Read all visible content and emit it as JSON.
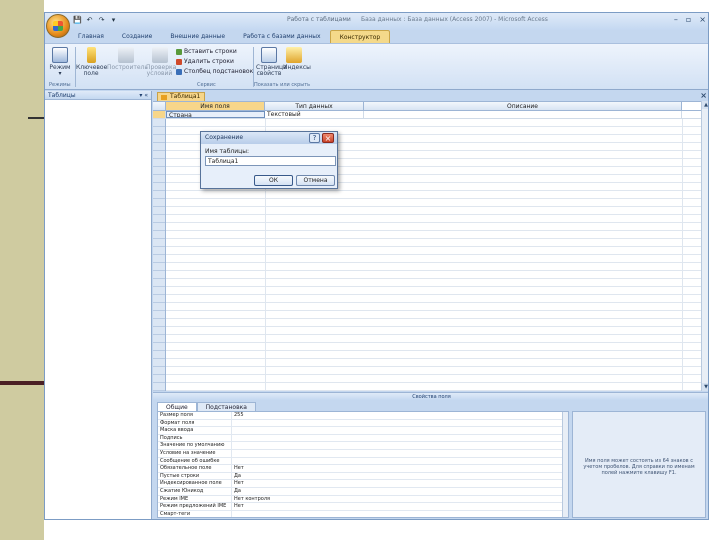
{
  "window": {
    "title_tools": "Работа с таблицами",
    "title_main": "База данных : База данных (Access 2007) - Microsoft Access",
    "controls": [
      "–",
      "▫",
      "×"
    ]
  },
  "qat": [
    "💾",
    "↶",
    "↷",
    "▾"
  ],
  "ribbon_tabs": [
    {
      "label": "Главная",
      "active": false
    },
    {
      "label": "Создание",
      "active": false
    },
    {
      "label": "Внешние данные",
      "active": false
    },
    {
      "label": "Работа с базами данных",
      "active": false
    },
    {
      "label": "Конструктор",
      "active": true
    }
  ],
  "ribbon": {
    "view_label": "Режим",
    "view_sub": "▾",
    "views_group": "Режимы",
    "key_label": "Ключевое поле",
    "builder_label": "Построитель",
    "test_label": "Проверка условий",
    "insert_rows": "Вставить строки",
    "delete_rows": "Удалить строки",
    "lookup_column": "Столбец подстановок",
    "tools_group": "Сервис",
    "property_sheet": "Страница свойств",
    "indexes": "Индексы",
    "showhide_group": "Показать или скрыть"
  },
  "nav": {
    "title": "Таблицы",
    "controls": "▾ «"
  },
  "document": {
    "tab_label": "Таблица1",
    "close": "×",
    "columns": [
      "Имя поля",
      "Тип данных",
      "Описание"
    ],
    "row1": {
      "field": "Страна",
      "type": "Текстовый",
      "desc": ""
    }
  },
  "properties": {
    "bar_label": "Свойства поля",
    "tabs": [
      {
        "label": "Общие",
        "active": true
      },
      {
        "label": "Подстановка",
        "active": false
      }
    ],
    "rows": [
      {
        "label": "Размер поля",
        "value": "255"
      },
      {
        "label": "Формат поля",
        "value": ""
      },
      {
        "label": "Маска ввода",
        "value": ""
      },
      {
        "label": "Подпись",
        "value": ""
      },
      {
        "label": "Значение по умолчанию",
        "value": ""
      },
      {
        "label": "Условие на значение",
        "value": ""
      },
      {
        "label": "Сообщение об ошибке",
        "value": ""
      },
      {
        "label": "Обязательное поле",
        "value": "Нет"
      },
      {
        "label": "Пустые строки",
        "value": "Да"
      },
      {
        "label": "Индексированное поле",
        "value": "Нет"
      },
      {
        "label": "Сжатие Юникод",
        "value": "Да"
      },
      {
        "label": "Режим IME",
        "value": "Нет контроля"
      },
      {
        "label": "Режим предложений IME",
        "value": "Нет"
      },
      {
        "label": "Смарт-теги",
        "value": ""
      }
    ],
    "help_text": "Имя поля может состоять из 64 знаков с учетом пробелов. Для справки по именам полей нажмите клавишу F1."
  },
  "dialog": {
    "title": "Сохранение",
    "help": "?",
    "close": "×",
    "label": "Имя таблицы:",
    "input_value": "Таблица1",
    "ok": "ОК",
    "cancel": "Отмена"
  },
  "colors": {
    "slide_band": "#cfcba0",
    "slide_line": "#4a1f24",
    "ribbon_active_tab": "#f4d98a",
    "office_blue": "#c4d7ef"
  }
}
